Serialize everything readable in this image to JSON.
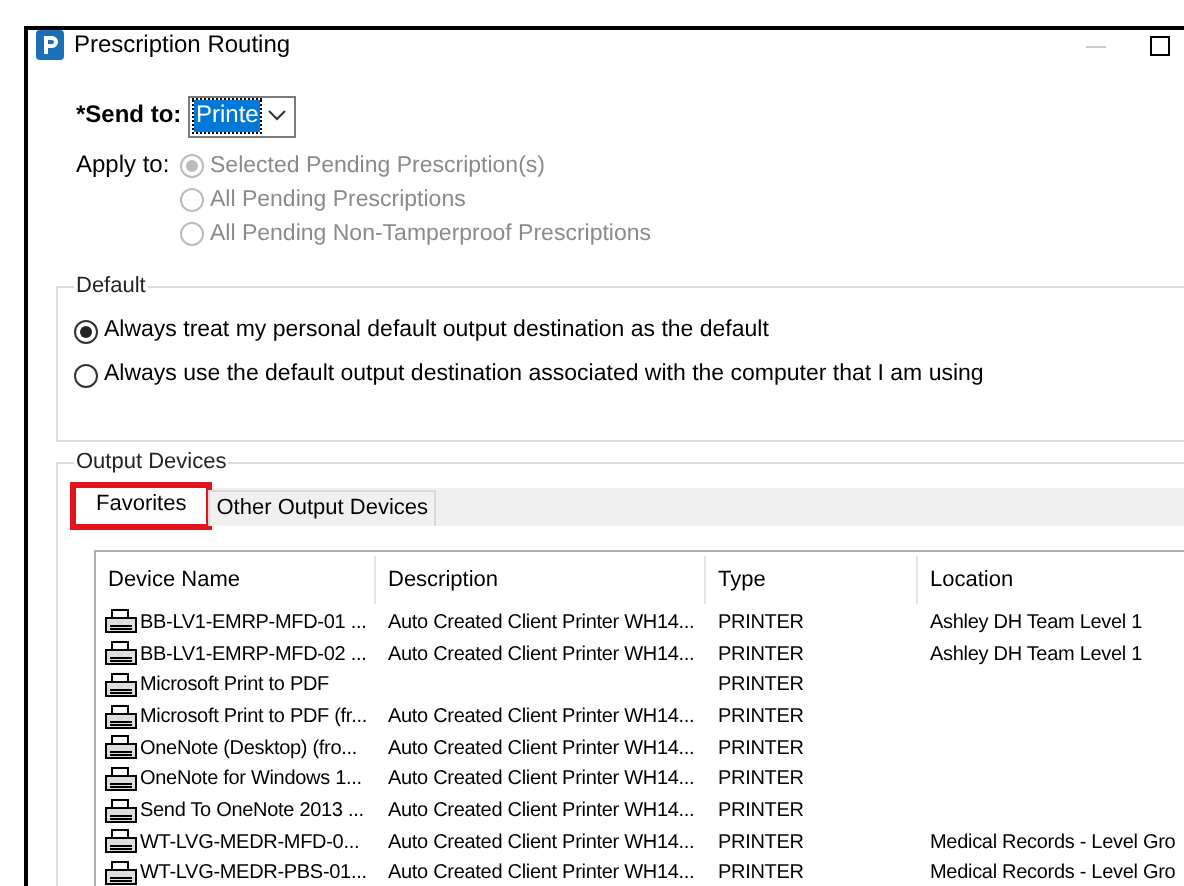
{
  "window": {
    "title": "Prescription Routing"
  },
  "send_to": {
    "label": "*Send to:",
    "value": "Printe"
  },
  "apply_to": {
    "label": "Apply to:",
    "options": [
      {
        "label": "Selected Pending Prescription(s)",
        "selected": true,
        "disabled": true
      },
      {
        "label": "All Pending Prescriptions",
        "selected": false,
        "disabled": true
      },
      {
        "label": "All Pending Non-Tamperproof Prescriptions",
        "selected": false,
        "disabled": true
      }
    ]
  },
  "default_group": {
    "title": "Default",
    "options": [
      {
        "label": "Always treat my personal default output destination as the default",
        "selected": true
      },
      {
        "label": "Always use the default output destination associated with the computer that I am using",
        "selected": false
      }
    ]
  },
  "output_devices": {
    "title": "Output Devices",
    "tabs": [
      {
        "label": "Favorites",
        "selected": true,
        "highlighted": true
      },
      {
        "label": "Other Output Devices",
        "selected": false,
        "highlighted": false
      }
    ],
    "table": {
      "columns": [
        "Device Name",
        "Description",
        "Type",
        "Location"
      ],
      "rows": [
        {
          "device_name": "BB-LV1-EMRP-MFD-01 ...",
          "description": "Auto Created Client Printer WH14...",
          "type": "PRINTER",
          "location": "Ashley DH Team Level 1"
        },
        {
          "device_name": "BB-LV1-EMRP-MFD-02 ...",
          "description": "Auto Created Client Printer WH14...",
          "type": "PRINTER",
          "location": "Ashley DH Team Level 1"
        },
        {
          "device_name": "Microsoft Print to PDF",
          "type": "PRINTER"
        },
        {
          "device_name": "Microsoft Print to PDF (fr...",
          "description": "Auto Created Client Printer WH14...",
          "type": "PRINTER"
        },
        {
          "device_name": "OneNote (Desktop) (fro...",
          "description": "Auto Created Client Printer WH14...",
          "type": "PRINTER"
        },
        {
          "device_name": "OneNote for Windows 1...",
          "description": "Auto Created Client Printer WH14...",
          "type": "PRINTER"
        },
        {
          "device_name": "Send To OneNote 2013 ...",
          "description": "Auto Created Client Printer WH14...",
          "type": "PRINTER"
        },
        {
          "device_name": "WT-LVG-MEDR-MFD-0...",
          "description": "Auto Created Client Printer WH14...",
          "type": "PRINTER",
          "location": "Medical Records - Level Gro"
        },
        {
          "device_name": "WT-LVG-MEDR-PBS-01...",
          "description": "Auto Created Client Printer WH14...",
          "type": "PRINTER",
          "location": "Medical Records - Level Gro"
        }
      ]
    }
  }
}
